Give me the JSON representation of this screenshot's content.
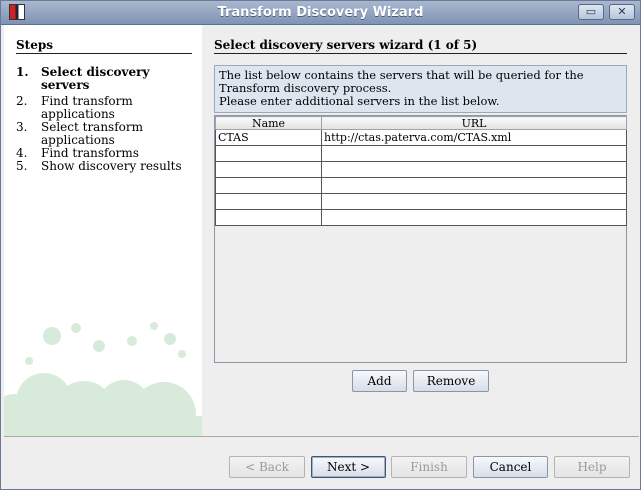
{
  "window": {
    "title": "Transform Discovery Wizard",
    "minimize_glyph": "▭",
    "close_glyph": "✕"
  },
  "steps": {
    "heading": "Steps",
    "items": [
      {
        "num": "1.",
        "label": "Select discovery servers",
        "current": true
      },
      {
        "num": "2.",
        "label": "Find transform applications",
        "current": false
      },
      {
        "num": "3.",
        "label": "Select transform applications",
        "current": false
      },
      {
        "num": "4.",
        "label": "Find transforms",
        "current": false
      },
      {
        "num": "5.",
        "label": "Show discovery results",
        "current": false
      }
    ]
  },
  "panel": {
    "title": "Select discovery servers wizard (1 of 5)",
    "info_lines": [
      "The list below contains the servers that will be queried for the",
      "Transform discovery process.",
      "Please enter additional servers in the list below."
    ]
  },
  "servers_table": {
    "columns": [
      "Name",
      "URL"
    ],
    "rows": [
      [
        "CTAS",
        "http://ctas.paterva.com/CTAS.xml"
      ],
      [
        "",
        ""
      ],
      [
        "",
        ""
      ],
      [
        "",
        ""
      ],
      [
        "",
        ""
      ],
      [
        "",
        ""
      ]
    ]
  },
  "table_buttons": {
    "add": "Add",
    "remove": "Remove"
  },
  "nav_buttons": {
    "back": "< Back",
    "next": "Next >",
    "finish": "Finish",
    "cancel": "Cancel",
    "help": "Help"
  },
  "colors": {
    "titlebar": "#8fa1bf",
    "info_bg": "#dde5ef",
    "bubbles": "#cfe6d2"
  }
}
